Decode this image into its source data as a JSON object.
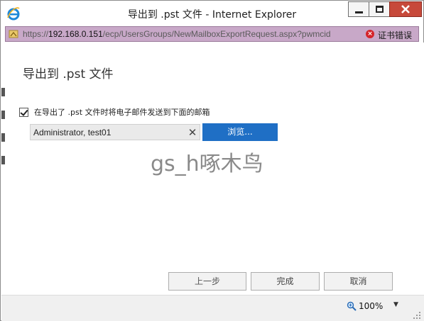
{
  "window": {
    "title": "导出到 .pst 文件 - Internet Explorer",
    "icon": "internet-explorer-icon"
  },
  "address_bar": {
    "scheme": "https://",
    "host": "192.168.0.151",
    "path": "/ecp/UsersGroups/NewMailboxExportRequest.aspx?pwmcid",
    "cert_status": "证书错误",
    "cert_icon": "error-x-icon"
  },
  "dialog": {
    "title": "导出到 .pst 文件",
    "checkbox_label": "在导出了 .pst 文件时将电子邮件发送到下面的邮箱",
    "checkbox_checked": true,
    "recipients": "Administrator, test01",
    "remove_label": "✕",
    "browse_label": "浏览...",
    "watermark": "gs_h啄木鸟"
  },
  "footer": {
    "back_label": "上一步",
    "done_label": "完成",
    "cancel_label": "取消"
  },
  "status_bar": {
    "zoom": "100%",
    "zoom_caret": "▼"
  },
  "colors": {
    "close_button": "#c7493a",
    "address_bar_bg": "#c8a8c8",
    "browse_button": "#1f6fc5",
    "cert_error": "#d4242a"
  }
}
